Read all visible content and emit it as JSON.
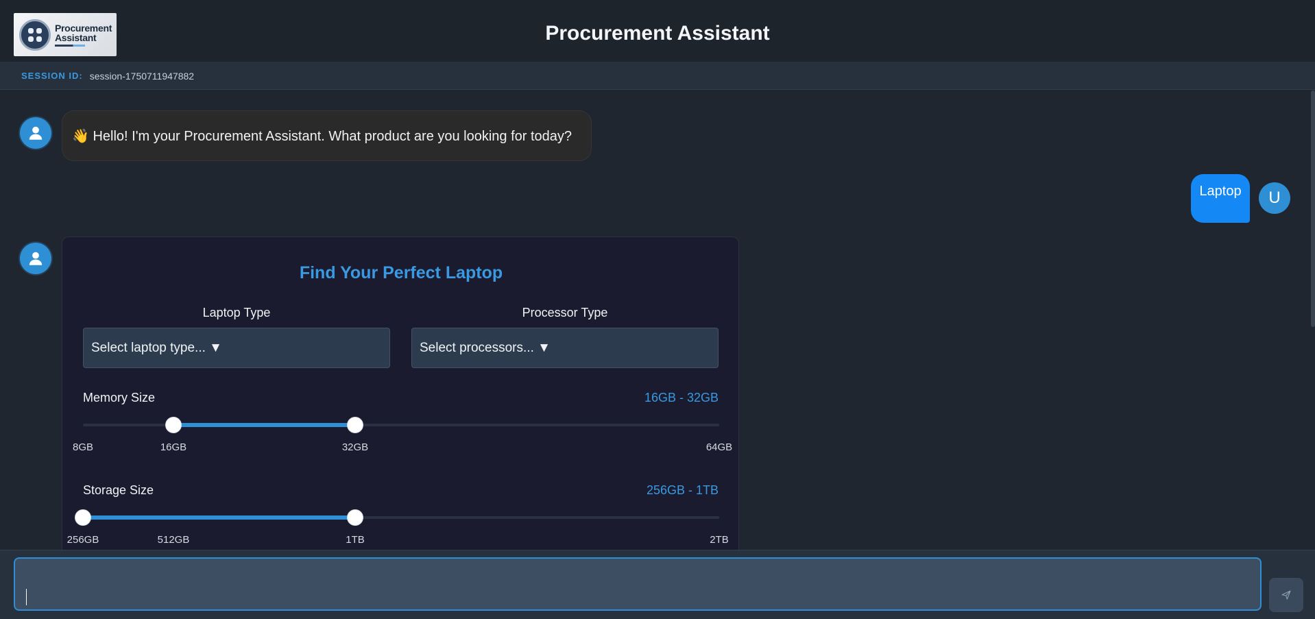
{
  "header": {
    "logo_text_line1": "Procurement",
    "logo_text_line2": "Assistant",
    "title": "Procurement Assistant"
  },
  "session": {
    "label": "SESSION ID:",
    "value": "session-1750711947882"
  },
  "messages": {
    "bot_greeting": "👋 Hello! I'm your Procurement Assistant. What product are you looking for today?",
    "user_reply": "Laptop",
    "user_avatar": "U"
  },
  "form": {
    "title": "Find Your Perfect Laptop",
    "laptop_type_label": "Laptop Type",
    "laptop_type_value": "Select laptop type... ▼",
    "processor_type_label": "Processor Type",
    "processor_type_value": "Select processors... ▼",
    "memory": {
      "label": "Memory Size",
      "range": "16GB - 32GB",
      "ticks": [
        "8GB",
        "16GB",
        "32GB",
        "64GB"
      ],
      "selected_min": "16GB",
      "selected_max": "32GB"
    },
    "storage": {
      "label": "Storage Size",
      "range": "256GB - 1TB",
      "ticks": [
        "256GB",
        "512GB",
        "1TB",
        "2TB"
      ],
      "selected_min": "256GB",
      "selected_max": "1TB"
    }
  },
  "input": {
    "placeholder": "",
    "value": ""
  },
  "icons": {
    "bot_avatar": "person-icon",
    "send": "send-icon"
  },
  "colors": {
    "accent": "#2f8fd4",
    "user_bubble": "#1488f5",
    "background": "#1f262f"
  }
}
